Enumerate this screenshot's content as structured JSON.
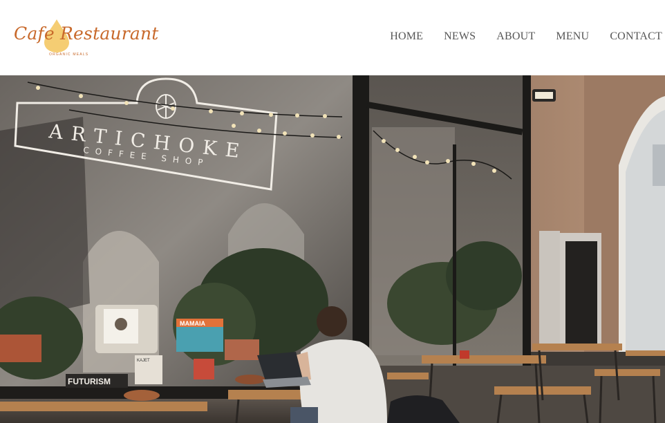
{
  "brand": {
    "title": "Cafe Restaurant",
    "subtitle": "ORGANIC MEALS",
    "accent": "#c8692b",
    "drop_color": "#f3c45a"
  },
  "nav": {
    "items": [
      {
        "label": "HOME"
      },
      {
        "label": "NEWS"
      },
      {
        "label": "ABOUT"
      },
      {
        "label": "MENU"
      },
      {
        "label": "CONTACT"
      }
    ]
  },
  "hero": {
    "sign_title": "ARTICHOKE",
    "sign_subtitle": "COFFEE SHOP",
    "poster_text": "MAMAIA",
    "shelf_sign": "FUTURISM",
    "card_text": "KAJET"
  }
}
